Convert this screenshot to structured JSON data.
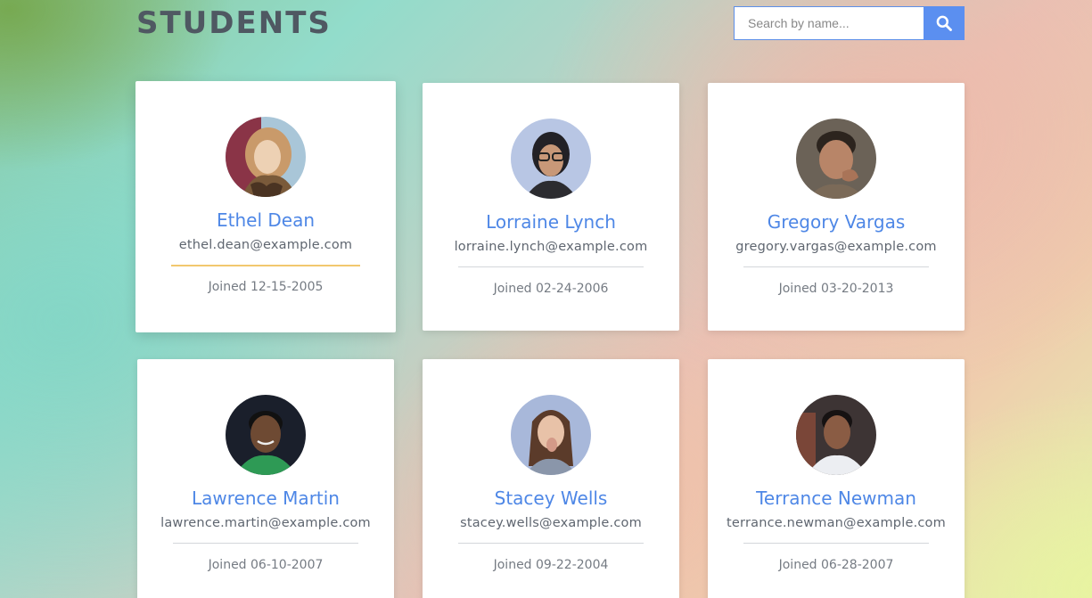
{
  "header": {
    "title": "STUDENTS",
    "search": {
      "placeholder": "Search by name...",
      "value": "",
      "button_icon": "search-icon"
    }
  },
  "colors": {
    "accent": "#5b8ff0",
    "name": "#4e87e6",
    "hover_divider": "#f2c86e"
  },
  "students": [
    {
      "name": "Ethel Dean",
      "email": "ethel.dean@example.com",
      "joined": "Joined 12-15-2005",
      "avatar": "student-photo",
      "hovered": true
    },
    {
      "name": "Lorraine Lynch",
      "email": "lorraine.lynch@example.com",
      "joined": "Joined 02-24-2006",
      "avatar": "student-photo",
      "hovered": false
    },
    {
      "name": "Gregory Vargas",
      "email": "gregory.vargas@example.com",
      "joined": "Joined 03-20-2013",
      "avatar": "student-photo",
      "hovered": false
    },
    {
      "name": "Lawrence Martin",
      "email": "lawrence.martin@example.com",
      "joined": "Joined 06-10-2007",
      "avatar": "student-photo",
      "hovered": false
    },
    {
      "name": "Stacey Wells",
      "email": "stacey.wells@example.com",
      "joined": "Joined 09-22-2004",
      "avatar": "student-photo",
      "hovered": false
    },
    {
      "name": "Terrance Newman",
      "email": "terrance.newman@example.com",
      "joined": "Joined 06-28-2007",
      "avatar": "student-photo",
      "hovered": false
    }
  ]
}
